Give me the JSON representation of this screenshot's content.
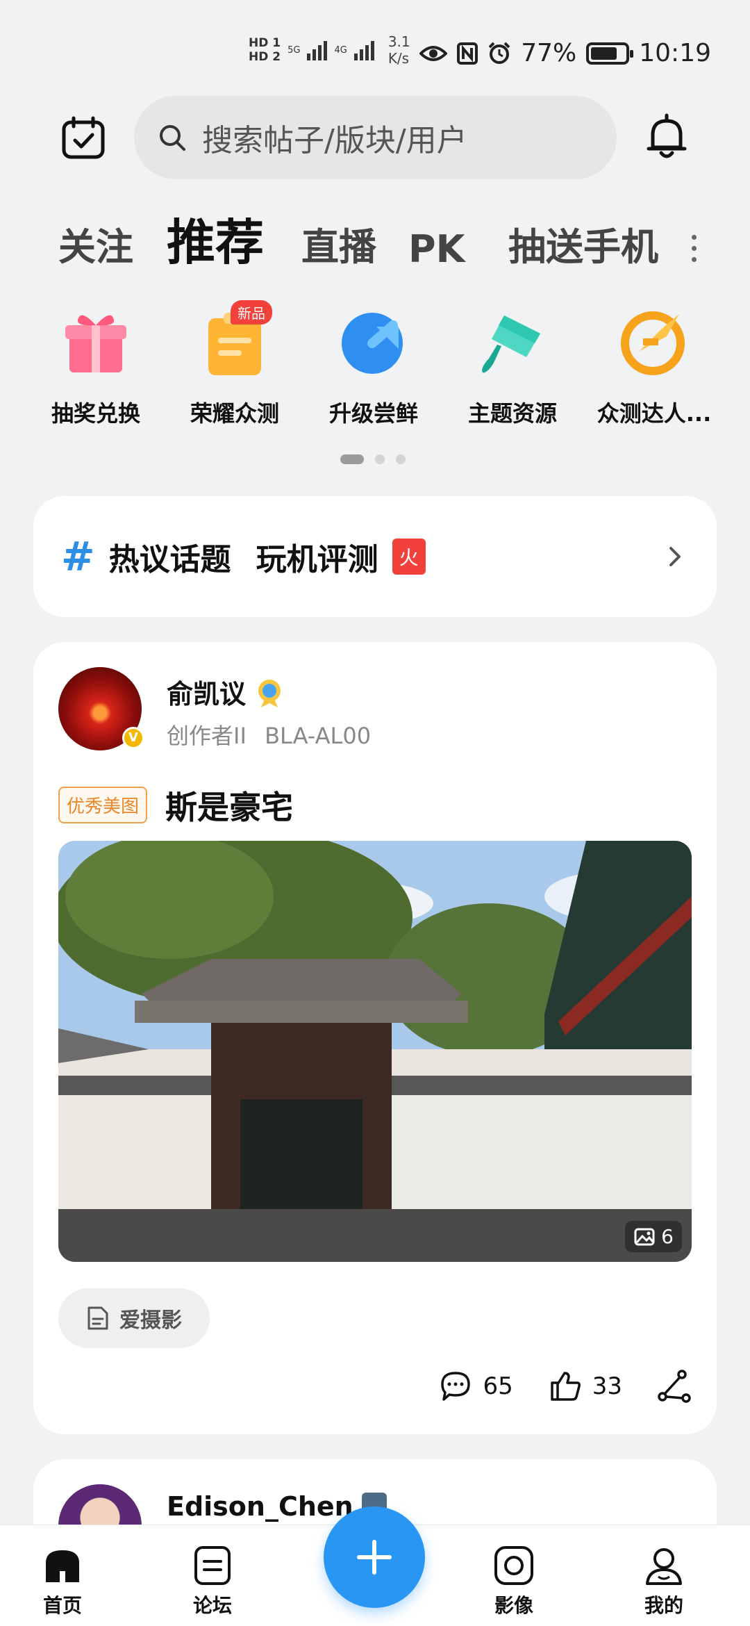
{
  "status_bar": {
    "hd1": "HD 1",
    "hd2": "HD 2",
    "net1": "5G",
    "net2": "4G",
    "speed_value": "3.1",
    "speed_unit": "K/s",
    "battery": "77%",
    "time": "10:19"
  },
  "header": {
    "search_placeholder": "搜索帖子/版块/用户"
  },
  "tabs": [
    {
      "label": "关注",
      "active": false
    },
    {
      "label": "推荐",
      "active": true
    },
    {
      "label": "直播",
      "active": false
    },
    {
      "label": "PK",
      "active": false
    },
    {
      "label": "抽送手机",
      "active": false
    }
  ],
  "quick_links": [
    {
      "label": "抽奖兑换",
      "icon": "gift-icon"
    },
    {
      "label": "荣耀众测",
      "icon": "clipboard-icon",
      "badge": "新品"
    },
    {
      "label": "升级尝鲜",
      "icon": "upgrade-icon"
    },
    {
      "label": "主题资源",
      "icon": "paint-brush-icon"
    },
    {
      "label": "众测达人...",
      "icon": "expert-badge-icon"
    }
  ],
  "hot": {
    "hash": "#",
    "title": "热议话题",
    "topic": "玩机评测",
    "badge": "火"
  },
  "post": {
    "author": "俞凯议",
    "role": "创作者II",
    "device": "BLA-AL00",
    "verified": "V",
    "tag": "优秀美图",
    "title": "斯是豪宅",
    "image_count": "6",
    "forum": "爱摄影",
    "comments": "65",
    "likes": "33"
  },
  "post2": {
    "author": "Edison_Chen"
  },
  "bottom_nav": [
    {
      "label": "首页",
      "icon": "home-icon"
    },
    {
      "label": "论坛",
      "icon": "forum-icon"
    },
    {
      "label": "影像",
      "icon": "camera-icon"
    },
    {
      "label": "我的",
      "icon": "profile-icon"
    }
  ],
  "colors": {
    "accent": "#2a96f3",
    "hot_badge": "#f2413a",
    "tag_orange": "#e8862a"
  }
}
